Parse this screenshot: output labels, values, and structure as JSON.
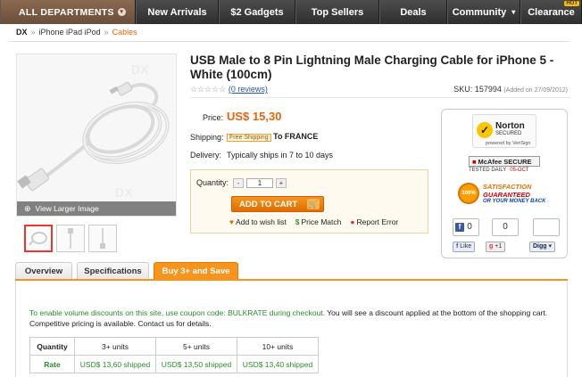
{
  "nav": {
    "departments": "ALL DEPARTMENTS",
    "items": [
      "New Arrivals",
      "$2 Gadgets",
      "Top Sellers",
      "Deals",
      "Community",
      "Clearance"
    ],
    "clearance_badge": "HOT"
  },
  "breadcrumb": [
    "DX",
    "iPhone iPad iPod",
    "Cables"
  ],
  "product": {
    "title": "USB Male to 8 Pin Lightning Male Charging Cable for iPhone 5 - White (100cm)",
    "reviews": "(0 reviews)",
    "sku_label": "SKU:",
    "sku": "157994",
    "added": "(Added on 27/09/2012)",
    "view_larger": "View Larger Image"
  },
  "details": {
    "price_label": "Price:",
    "price": "US$ 15,30",
    "shipping_label": "Shipping:",
    "free_shipping": "Free Shipping",
    "ship_to": "To FRANCE",
    "delivery_label": "Delivery:",
    "delivery": "Typically ships in 7 to 10 days"
  },
  "cart": {
    "quantity_label": "Quantity:",
    "quantity": "1",
    "minus": "-",
    "plus": "+",
    "add_to_cart": "ADD TO CART",
    "wish": "Add to wish list",
    "price_match": "Price Match",
    "report": "Report Error"
  },
  "trust": {
    "norton_top": "Norton",
    "norton_sub": "SECURED",
    "norton_by": "powered by VeriSign",
    "mcafee": "McAfee SECURE",
    "mcafee_tested": "TESTED DAILY",
    "mcafee_date": "05-OCT",
    "sat_seal": "100%",
    "sat1": "SATISFACTION",
    "sat2": "GUARANTEED",
    "sat3": "OR YOUR MONEY BACK",
    "fb_count": "0",
    "g_count": "0",
    "digg_count": "",
    "like": "Like",
    "plus1": "+1",
    "digg": "Digg"
  },
  "tabs": [
    "Overview",
    "Specifications",
    "Buy 3+ and Save"
  ],
  "promo": {
    "line1_green": "To enable volume discounts on this site, use coupon code: BULKRATE during checkout.",
    "line1_rest": " You will see a discount applied at the bottom of the shopping cart.",
    "line2": "Competitive pricing is available. Contact us for details."
  },
  "volume_table": {
    "header": [
      "Quantity",
      "3+ units",
      "5+ units",
      "10+ units"
    ],
    "rate": [
      "Rate",
      "USD$ 13,60 shipped",
      "USD$ 13,50 shipped",
      "USD$ 13,40 shipped"
    ]
  }
}
